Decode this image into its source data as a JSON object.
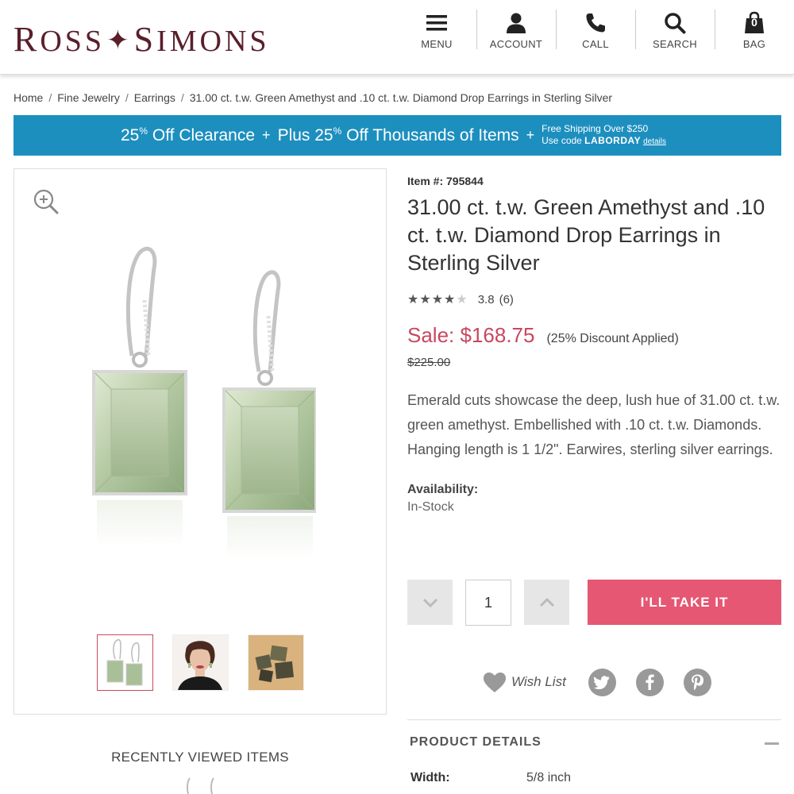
{
  "header": {
    "logo": {
      "part1_initial": "R",
      "part1_rest": "OSS",
      "part2_initial": "S",
      "part2_rest": "IMONS",
      "star": "✦"
    },
    "nav": [
      {
        "label": "MENU",
        "icon": "menu-icon"
      },
      {
        "label": "ACCOUNT",
        "icon": "account-icon"
      },
      {
        "label": "CALL",
        "icon": "phone-icon"
      },
      {
        "label": "SEARCH",
        "icon": "search-icon"
      },
      {
        "label": "BAG",
        "icon": "bag-icon",
        "count": "0"
      }
    ]
  },
  "breadcrumb": {
    "items": [
      "Home",
      "Fine Jewelry",
      "Earrings",
      "31.00 ct. t.w. Green Amethyst and .10 ct. t.w. Diamond Drop Earrings in Sterling Silver"
    ],
    "separator": "/"
  },
  "promo": {
    "offer1_number": "25",
    "offer1_pct": "%",
    "offer1_text": " Off Clearance",
    "plus": "+",
    "offer2_prefix": "Plus 25",
    "offer2_pct": "%",
    "offer2_text": " Off Thousands of Items",
    "shipping": "Free Shipping Over $250",
    "code_prefix": "Use code ",
    "code": "LABORDAY",
    "details": "details",
    "bg_color": "#1d8fbf"
  },
  "product": {
    "item_label": "Item #:",
    "item_number": "795844",
    "title": "31.00 ct. t.w. Green Amethyst and .10 ct. t.w. Diamond Drop Earrings in Sterling Silver",
    "rating": {
      "stars_on": "★★★★",
      "stars_off": "★",
      "value": "3.8",
      "count": "(6)"
    },
    "sale_price": "Sale: $168.75",
    "discount": "(25% Discount Applied)",
    "original_price": "$225.00",
    "description": "Emerald cuts showcase the deep, lush hue of 31.00 ct. t.w. green amethyst. Embellished with .10 ct. t.w. Diamonds. Hanging length is 1 1/2\". Earwires, sterling silver earrings.",
    "availability_label": "Availability:",
    "availability": "In-Stock",
    "quantity": "1",
    "cta": "I'LL TAKE IT",
    "sale_color": "#c8485f",
    "cta_color": "#e55772"
  },
  "social": {
    "wish_list": "Wish List",
    "icons": [
      "twitter-icon",
      "facebook-icon",
      "pinterest-icon"
    ]
  },
  "details": {
    "title": "PRODUCT DETAILS",
    "rows": [
      {
        "label": "Width:",
        "value": "5/8 inch"
      }
    ]
  },
  "recent": {
    "title": "RECENTLY VIEWED ITEMS"
  },
  "thumbnails": [
    "earrings-thumb",
    "model-thumb",
    "gemstone-thumb"
  ]
}
